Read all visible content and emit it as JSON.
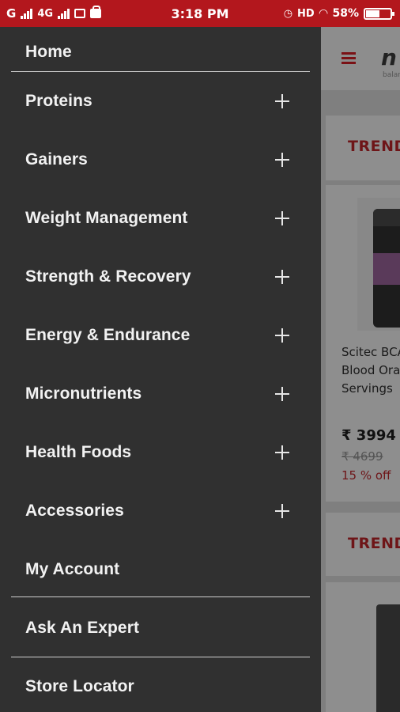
{
  "status_bar": {
    "left": "G",
    "network": "4G",
    "time": "3:18 PM",
    "hd": "HD",
    "battery": "58%",
    "battery_level": 0.58,
    "color": "#b3171d"
  },
  "drawer": {
    "items": [
      {
        "label": "Home",
        "expandable": false
      },
      {
        "label": "Proteins",
        "expandable": true
      },
      {
        "label": "Gainers",
        "expandable": true
      },
      {
        "label": "Weight Management",
        "expandable": true
      },
      {
        "label": "Strength & Recovery",
        "expandable": true
      },
      {
        "label": "Energy & Endurance",
        "expandable": true
      },
      {
        "label": "Micronutrients",
        "expandable": true
      },
      {
        "label": "Health Foods",
        "expandable": true
      },
      {
        "label": "Accessories",
        "expandable": true
      },
      {
        "label": "My Account",
        "expandable": false
      },
      {
        "label": "Ask An Expert",
        "expandable": false
      },
      {
        "label": "Store Locator",
        "expandable": false
      }
    ]
  },
  "background_app": {
    "logo": "n",
    "logo_sub": "balanc",
    "section1_title": "TRENDI",
    "product": {
      "line1": "Scitec BCA",
      "line2": "Blood Oran",
      "line3": "Servings",
      "price": "₹ 3994",
      "mrp": "₹ 4699",
      "discount": "15 % off"
    },
    "section2_title": "TRENDI"
  }
}
